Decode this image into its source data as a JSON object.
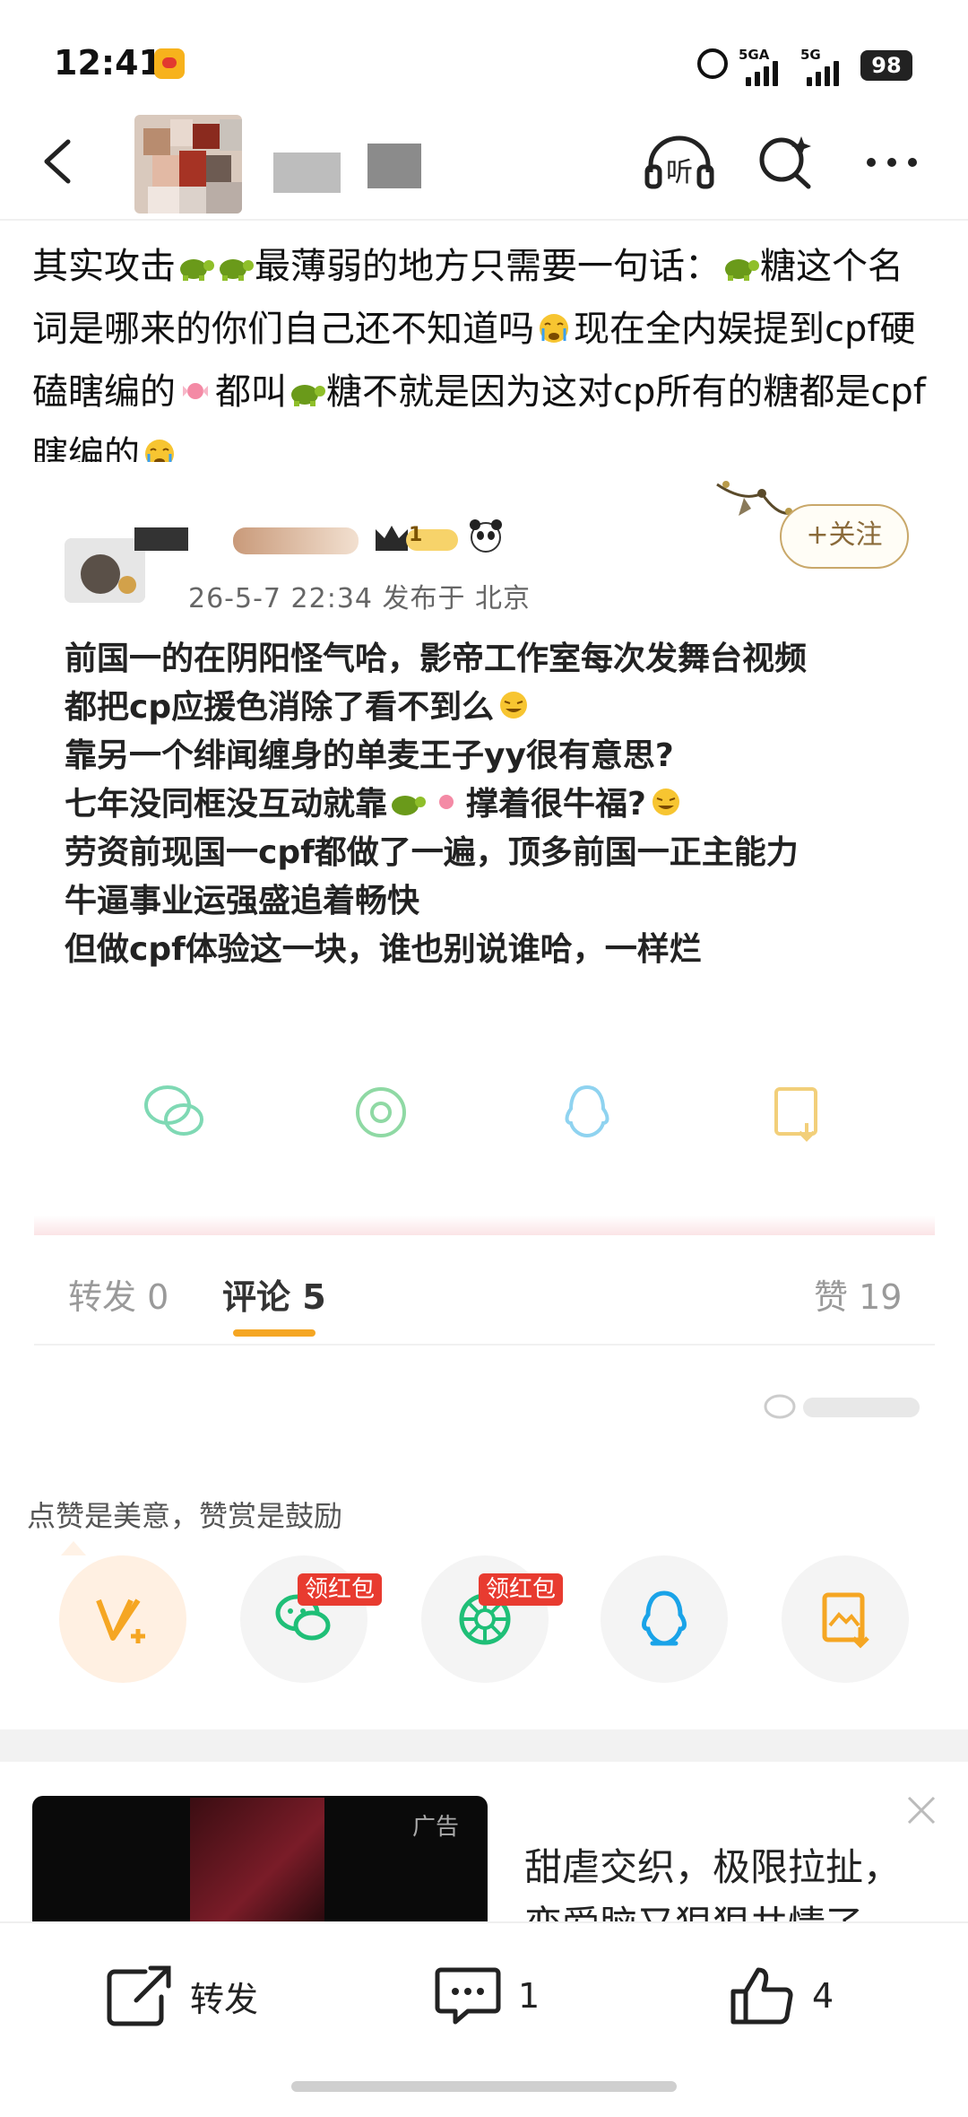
{
  "status_bar": {
    "time": "12:41",
    "network1": "5GA",
    "network2": "5G",
    "battery": "98"
  },
  "header": {
    "back_icon": "chevron-left-icon",
    "listen_label": "听",
    "search_icon": "search-sparkle-icon",
    "more_icon": "more-dots-icon"
  },
  "post": {
    "text_parts": [
      "其实攻击",
      "最薄弱的地方只需要一句话：",
      "糖这个名词是哪来的你们自己还不知道吗",
      "现在全内娱提到cpf硬磕瞎编的",
      "都叫",
      "糖不就是因为这对cp所有的糖都是cpf瞎编的"
    ]
  },
  "embedded_post": {
    "vip_level": "1",
    "meta": "26-5-7 22:34  发布于 北京",
    "follow_label": "+关注",
    "lines": [
      "前国一的在阴阳怪气哈，影帝工作室每次发舞台视频",
      "都把cp应援色消除了看不到么",
      "靠另一个绯闻缠身的单麦王子yy很有意思?",
      "七年没同框没互动就靠",
      "撑着很牛福?",
      "劳资前现国一cpf都做了一遍，顶多前国一正主能力",
      "牛逼事业运强盛追着畅快",
      "但做cpf体验这一块，谁也别说谁哈，一样烂"
    ],
    "tabs": {
      "repost": "转发 0",
      "comment": "评论 5",
      "like": "赞 19"
    }
  },
  "reward": {
    "hint": "点赞是美意，赞赏是鼓励",
    "red_packet_label": "领红包",
    "items": [
      "reward-v-icon",
      "wechat-icon",
      "moments-icon",
      "qq-icon",
      "save-image-icon"
    ]
  },
  "ad": {
    "label": "广告",
    "text_line1": "甜虐交织，极限拉扯，",
    "text_line2": "恋爱脑又狠狠共情了"
  },
  "bottom_bar": {
    "repost_label": "转发",
    "comment_count": "1",
    "like_count": "4"
  },
  "colors": {
    "accent_orange": "#f5a623",
    "red_tag": "#e83b30",
    "wechat_green": "#1fbf77",
    "qq_blue": "#1aa3e8"
  }
}
